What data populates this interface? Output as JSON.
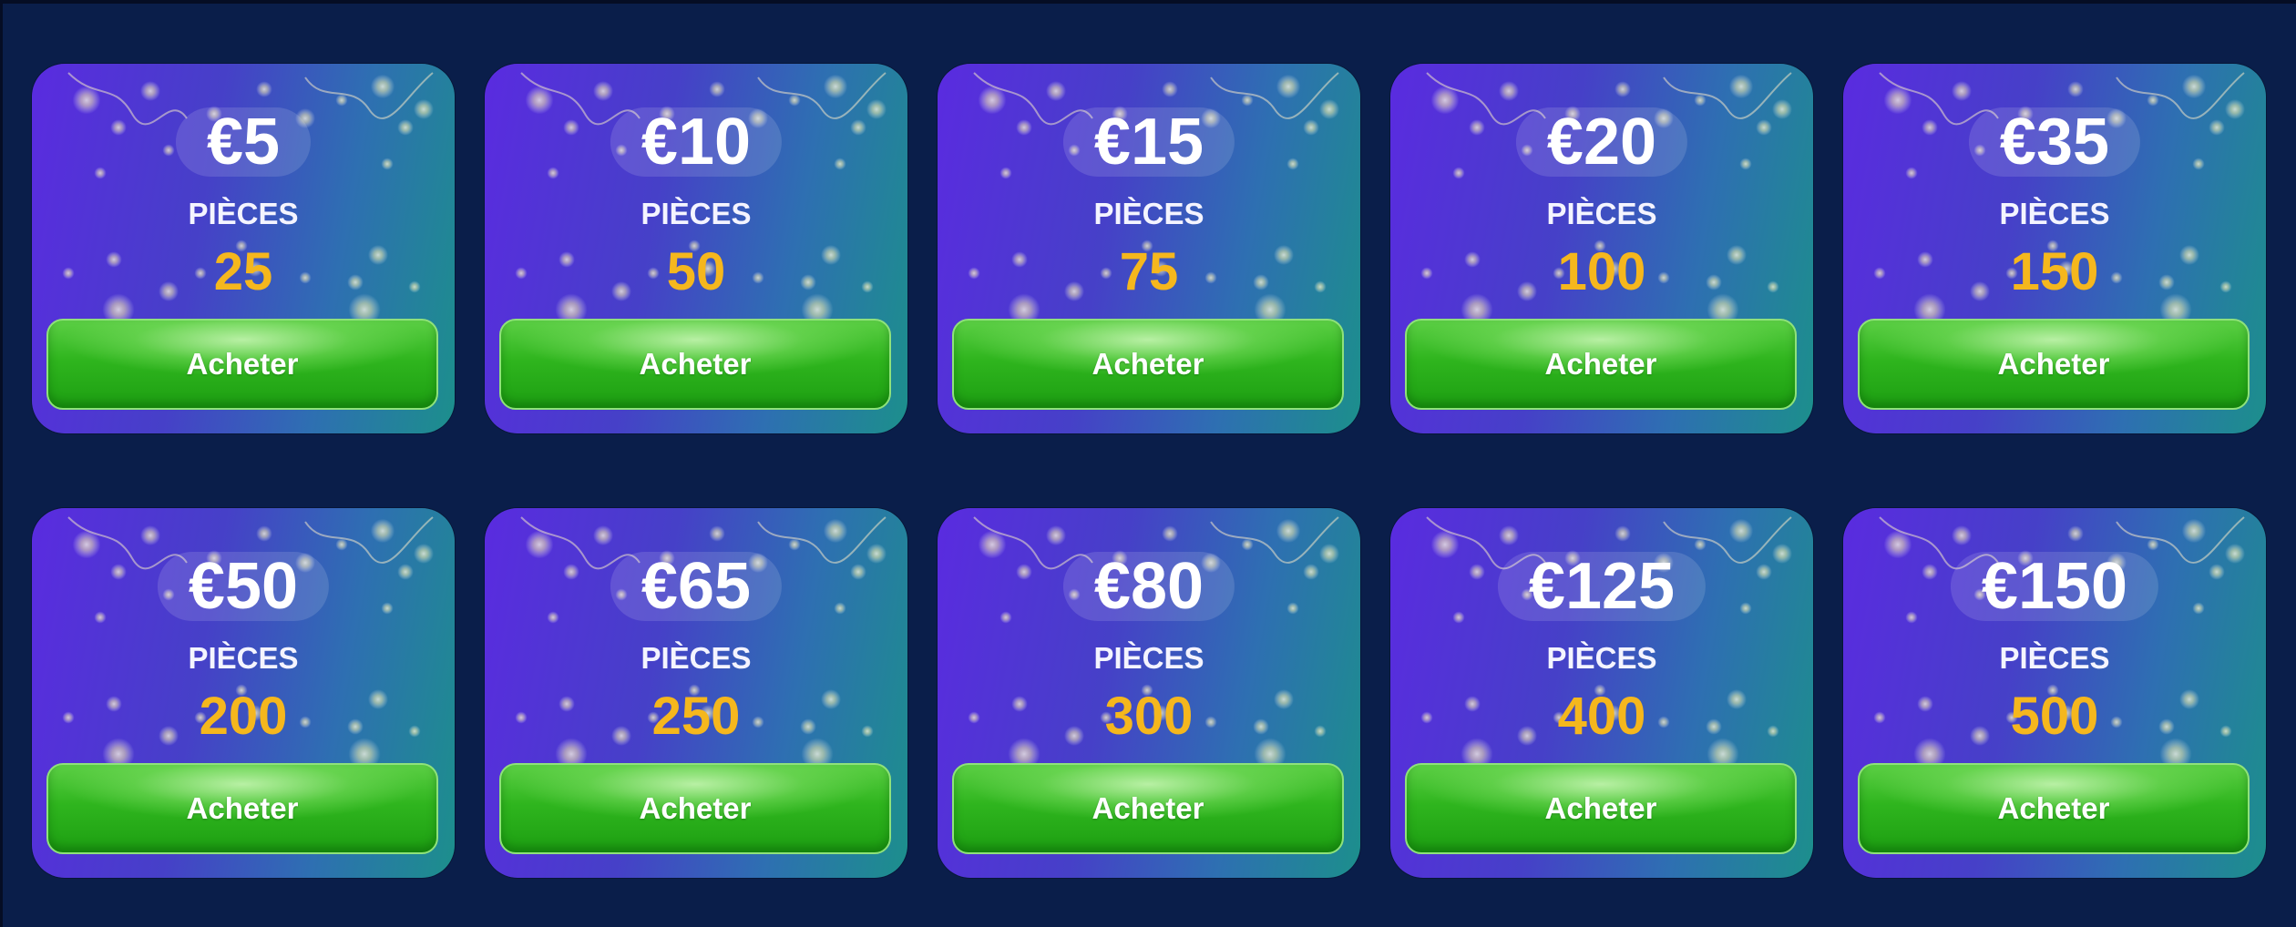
{
  "colors": {
    "background": "#0a1e4a",
    "card_gradient_start": "#5a2be0",
    "card_gradient_end": "#1c8f8c",
    "coin_amount": "#f5b71d",
    "buy_button": "#2fb51e"
  },
  "packs": [
    {
      "price": "€5",
      "label": "PIÈCES",
      "coins": "25",
      "button_label": "Acheter"
    },
    {
      "price": "€10",
      "label": "PIÈCES",
      "coins": "50",
      "button_label": "Acheter"
    },
    {
      "price": "€15",
      "label": "PIÈCES",
      "coins": "75",
      "button_label": "Acheter"
    },
    {
      "price": "€20",
      "label": "PIÈCES",
      "coins": "100",
      "button_label": "Acheter"
    },
    {
      "price": "€35",
      "label": "PIÈCES",
      "coins": "150",
      "button_label": "Acheter"
    },
    {
      "price": "€50",
      "label": "PIÈCES",
      "coins": "200",
      "button_label": "Acheter"
    },
    {
      "price": "€65",
      "label": "PIÈCES",
      "coins": "250",
      "button_label": "Acheter"
    },
    {
      "price": "€80",
      "label": "PIÈCES",
      "coins": "300",
      "button_label": "Acheter"
    },
    {
      "price": "€125",
      "label": "PIÈCES",
      "coins": "400",
      "button_label": "Acheter"
    },
    {
      "price": "€150",
      "label": "PIÈCES",
      "coins": "500",
      "button_label": "Acheter"
    }
  ]
}
